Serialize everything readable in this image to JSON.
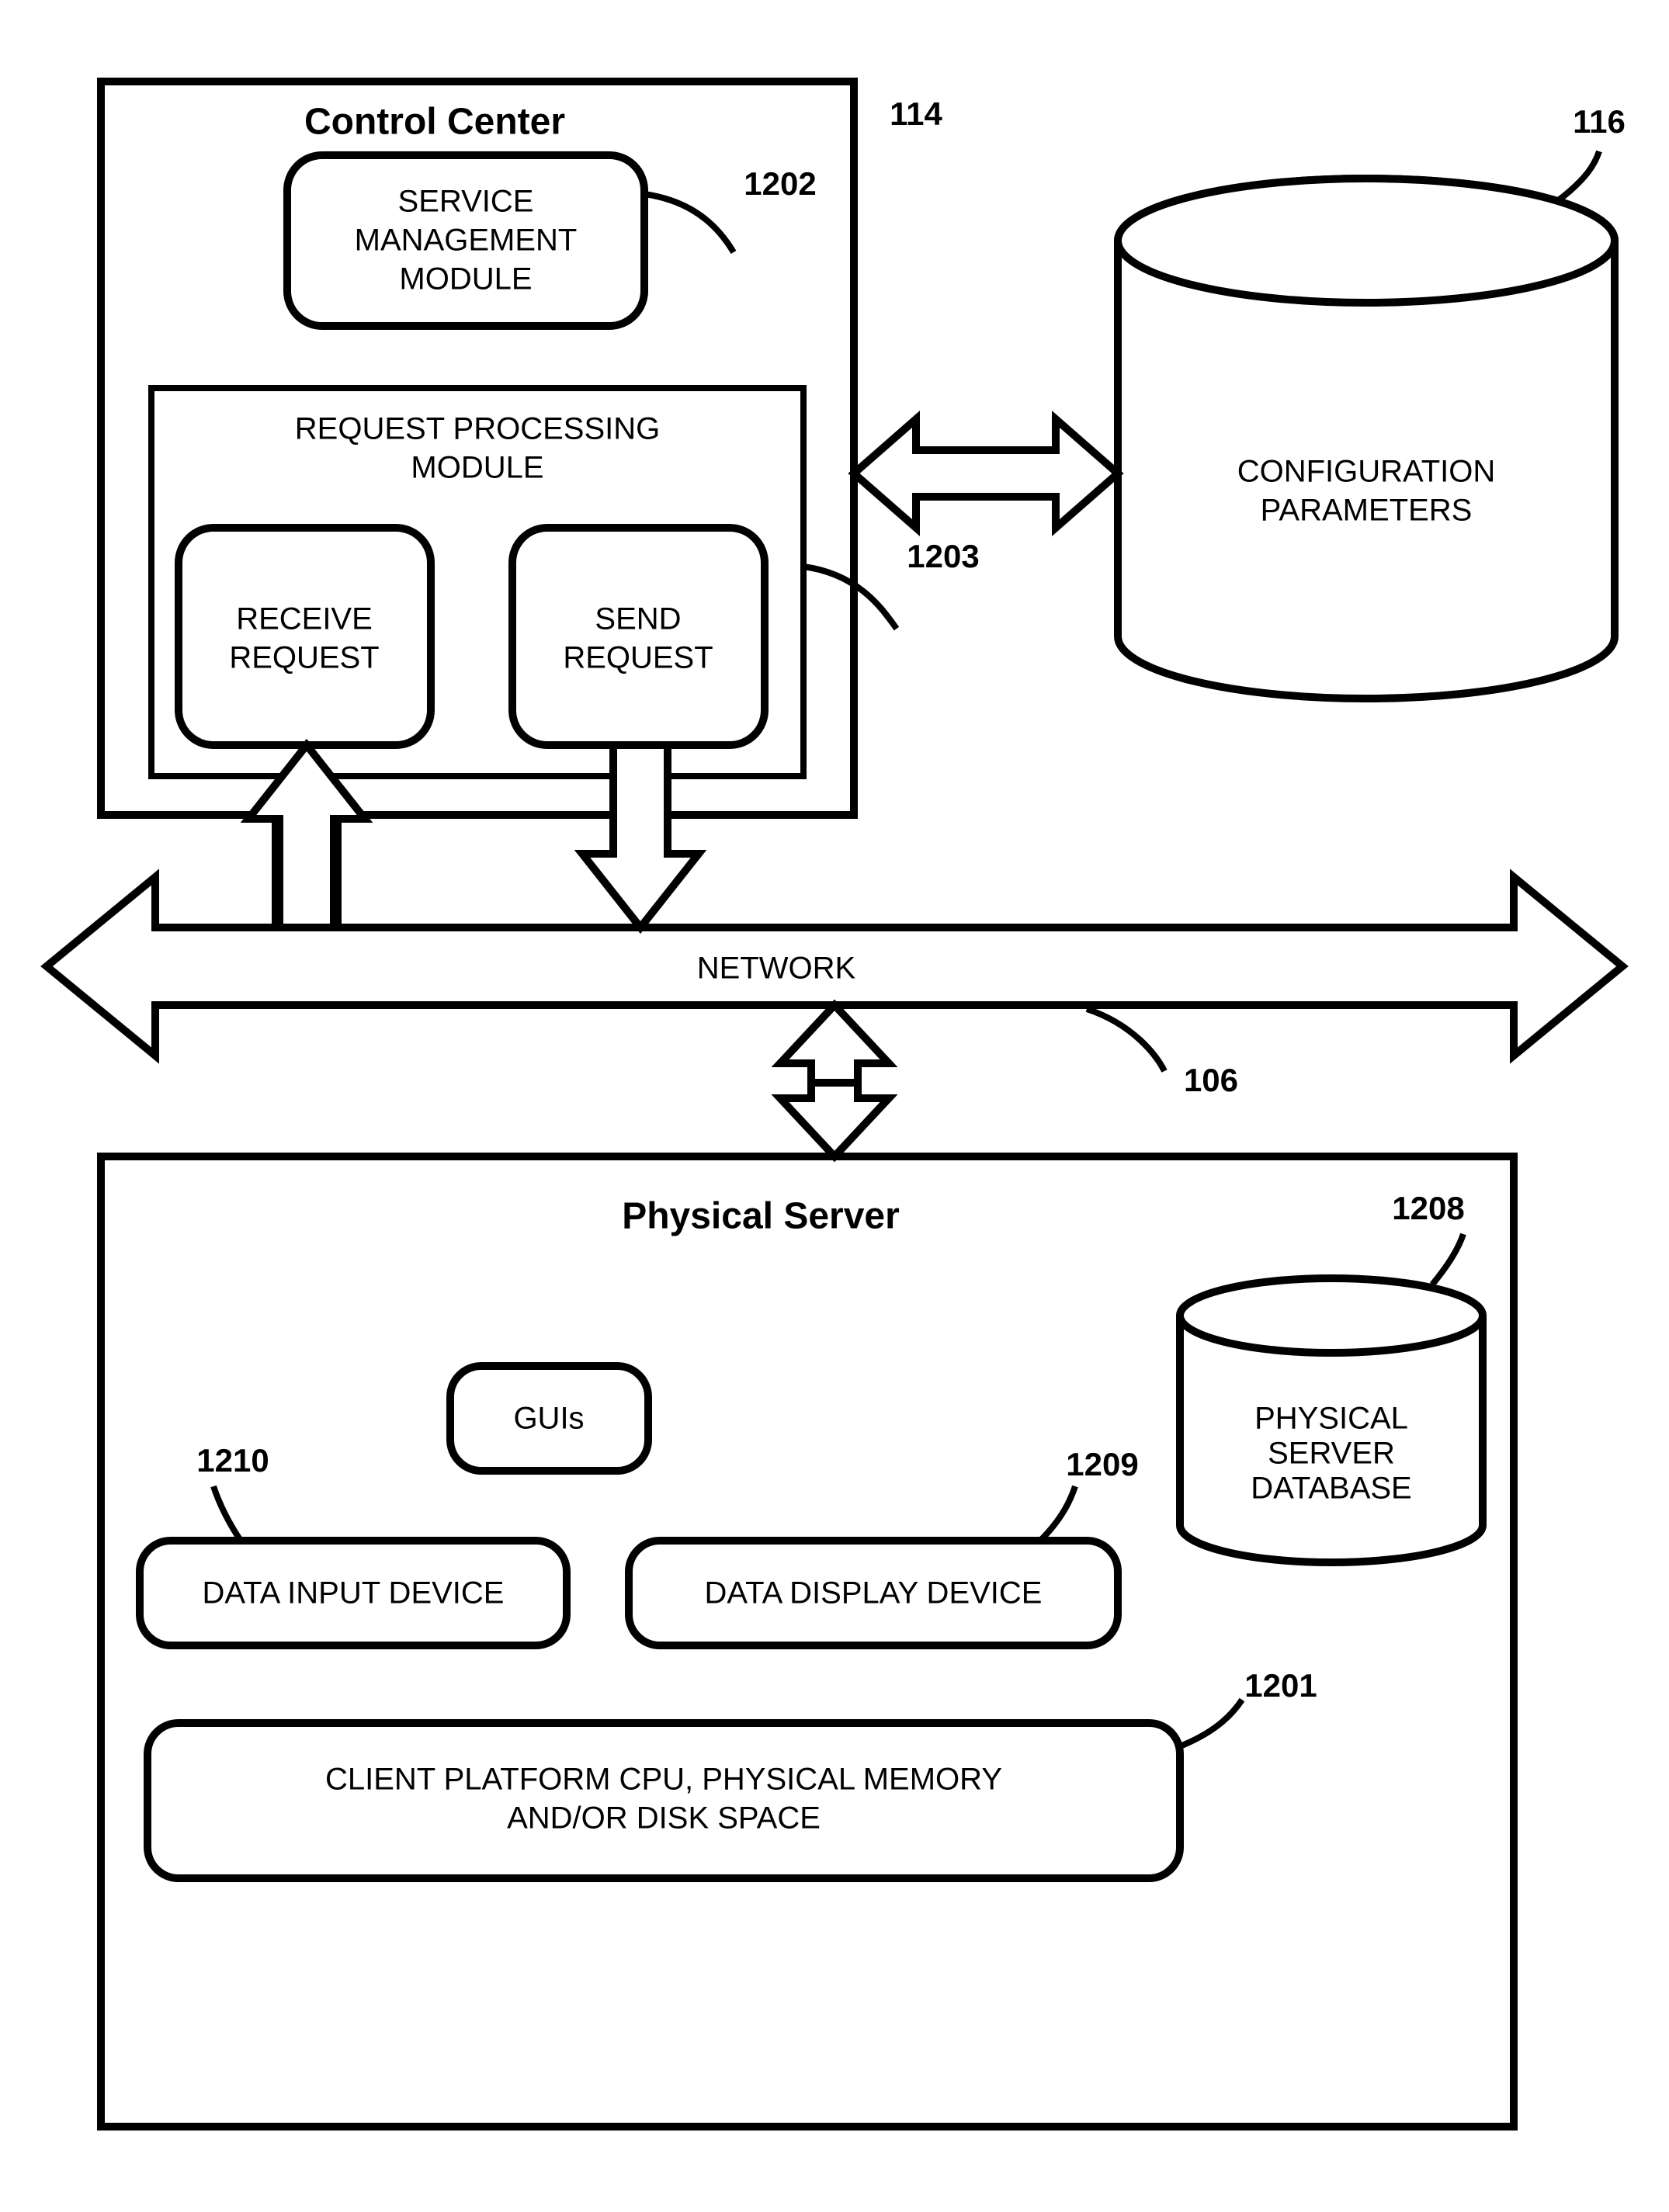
{
  "control_center": {
    "title": "Control Center",
    "service_mgmt": {
      "l1": "SERVICE",
      "l2": "MANAGEMENT",
      "l3": "MODULE"
    },
    "req_proc": {
      "title_l1": "REQUEST PROCESSING",
      "title_l2": "MODULE",
      "receive": {
        "l1": "RECEIVE",
        "l2": "REQUEST"
      },
      "send": {
        "l1": "SEND",
        "l2": "REQUEST"
      }
    }
  },
  "config_db": {
    "l1": "CONFIGURATION",
    "l2": "PARAMETERS"
  },
  "network": {
    "label": "NETWORK"
  },
  "physical_server": {
    "title": "Physical Server",
    "guis": "GUIs",
    "data_input": "DATA INPUT DEVICE",
    "data_display": "DATA DISPLAY DEVICE",
    "resources": {
      "l1": "CLIENT PLATFORM CPU, PHYSICAL MEMORY",
      "l2": "AND/OR DISK SPACE"
    },
    "db": {
      "l1": "PHYSICAL",
      "l2": "SERVER",
      "l3": "DATABASE"
    }
  },
  "refs": {
    "control_center": "114",
    "config_db": "116",
    "service_mgmt": "1202",
    "req_proc": "1203",
    "network": "106",
    "ps_db": "1208",
    "data_display": "1209",
    "data_input": "1210",
    "resources": "1201"
  }
}
